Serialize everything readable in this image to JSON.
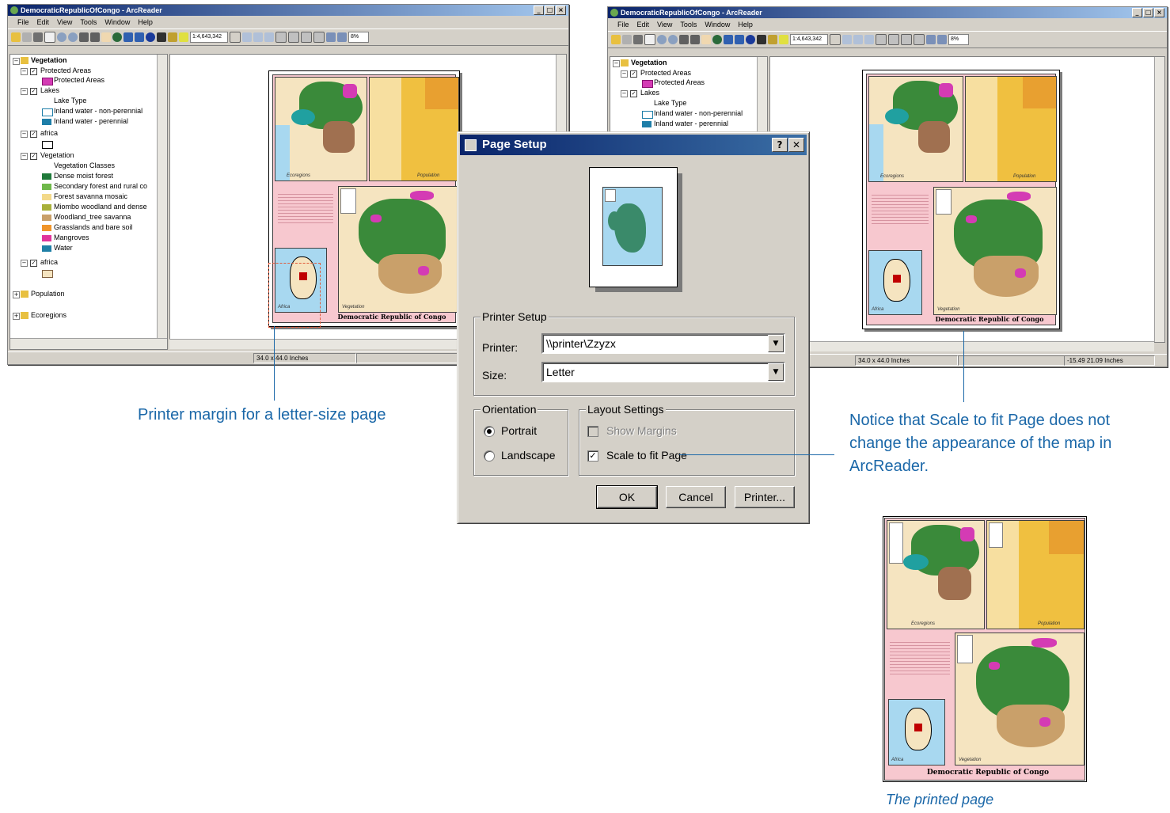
{
  "left_window": {
    "title": "DemocraticRepublicOfCongo - ArcReader",
    "menu": [
      "File",
      "Edit",
      "View",
      "Tools",
      "Window",
      "Help"
    ],
    "scale": "1:4,643,342",
    "zoom": "8%",
    "toc": {
      "root": "Vegetation",
      "items": [
        {
          "label": "Protected Areas",
          "level": 1,
          "check": true
        },
        {
          "label": "Protected Areas",
          "level": 2,
          "swatch": "#d43bb4"
        },
        {
          "label": "Lakes",
          "level": 1,
          "check": true
        },
        {
          "label": "Lake Type",
          "level": 3
        },
        {
          "label": "Inland water - non-perennial",
          "level": 2,
          "swatch": "#ffffff"
        },
        {
          "label": "Inland water - perennial",
          "level": 2,
          "swatch": "#1e7ea8"
        },
        {
          "label": "africa",
          "level": 1,
          "check": true
        },
        {
          "label": "",
          "level": 2,
          "swatch": "#ffffff"
        },
        {
          "label": "Vegetation",
          "level": 1,
          "check": true
        },
        {
          "label": "Vegetation Classes",
          "level": 3
        },
        {
          "label": "Dense moist forest",
          "level": 2,
          "swatch": "#1f7a3a"
        },
        {
          "label": "Secondary forest and rural co",
          "level": 2,
          "swatch": "#6fb84a"
        },
        {
          "label": "Forest savanna mosaic",
          "level": 2,
          "swatch": "#f3d98a"
        },
        {
          "label": "Miombo woodland and dense",
          "level": 2,
          "swatch": "#a8b03a"
        },
        {
          "label": "Woodland_tree savanna",
          "level": 2,
          "swatch": "#c9a06a"
        },
        {
          "label": "Grasslands and bare soil",
          "level": 2,
          "swatch": "#f0952a"
        },
        {
          "label": "Mangroves",
          "level": 2,
          "swatch": "#e0349a"
        },
        {
          "label": "Water",
          "level": 2,
          "swatch": "#1f7fa6"
        },
        {
          "label": "africa",
          "level": 1,
          "check": true
        },
        {
          "label": "",
          "level": 2,
          "swatch": "#f5e4c0"
        },
        {
          "label": "Population",
          "level": 0
        },
        {
          "label": "Ecoregions",
          "level": 0
        }
      ]
    },
    "status_size": "34.0 x 44.0 Inches"
  },
  "right_window": {
    "title": "DemocraticRepublicOfCongo - ArcReader",
    "menu": [
      "File",
      "Edit",
      "View",
      "Tools",
      "Window",
      "Help"
    ],
    "scale": "1:4,643,342",
    "zoom": "8%",
    "toc": {
      "root": "Vegetation",
      "items": [
        {
          "label": "Protected Areas",
          "level": 1,
          "check": true
        },
        {
          "label": "Protected Areas",
          "level": 2,
          "swatch": "#d43bb4"
        },
        {
          "label": "Lakes",
          "level": 1,
          "check": true
        },
        {
          "label": "Lake Type",
          "level": 3
        },
        {
          "label": "Inland water - non-perennial",
          "level": 2,
          "swatch": "#ffffff"
        },
        {
          "label": "Inland water - perennial",
          "level": 2,
          "swatch": "#1e7ea8"
        }
      ]
    },
    "status_size": "34.0 x 44.0 Inches",
    "status_coords": "-15.49  21.09 Inches"
  },
  "map_layout": {
    "title": "Democratic Republic of Congo",
    "label_ecoregions": "Ecoregions",
    "label_population": "Population",
    "label_vegetation": "Vegetation",
    "label_africa": "Africa"
  },
  "dialog": {
    "title": "Page Setup",
    "help_btn": "?",
    "close_btn": "✕",
    "printer_setup_group": "Printer Setup",
    "printer_label": "Printer:",
    "printer_value": "\\\\printer\\Zzyzx",
    "size_label": "Size:",
    "size_value": "Letter",
    "orientation_group": "Orientation",
    "portrait": "Portrait",
    "landscape": "Landscape",
    "layout_group": "Layout Settings",
    "show_margins": "Show Margins",
    "scale_to_fit": "Scale to fit Page",
    "ok": "OK",
    "cancel": "Cancel",
    "printer_btn": "Printer..."
  },
  "captions": {
    "printer_margin": "Printer margin for a letter-size page",
    "notice_1": "Notice that Scale to fit Page does not",
    "notice_2": "change the appearance of the map in",
    "notice_3": "ArcReader.",
    "printed_page": "The printed page"
  },
  "colors": {
    "caption_blue": "#1a67a8",
    "title_bar": "#0a246a",
    "layout_pink": "#f7c8cf",
    "margin_red": "#e05a3a"
  }
}
